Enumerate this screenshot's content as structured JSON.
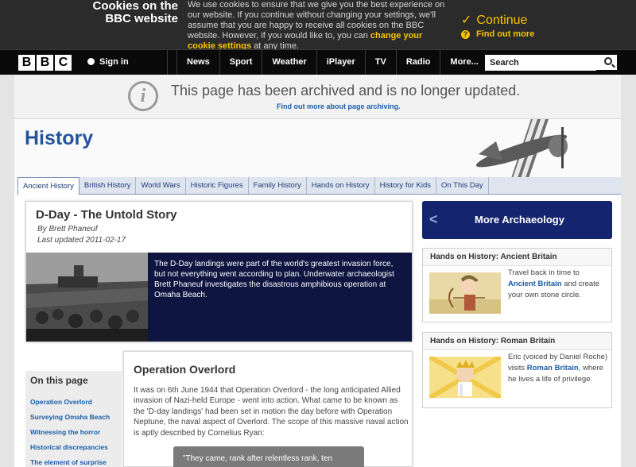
{
  "cookie_banner": {
    "title_line1": "Cookies on the",
    "title_line2": "BBC website",
    "text_start": "We use cookies to ensure that we give you the best experience on our website. If you continue without changing your settings, we'll assume that you are happy to receive all cookies on the BBC website. However, if you would like to, you can ",
    "text_link": "change your cookie settings",
    "text_end": " at any time.",
    "continue_label": "Continue",
    "find_out_more_label": "Find out more",
    "accent_color": "#f8c300"
  },
  "bbc_nav": {
    "logo_letters": [
      "B",
      "B",
      "C"
    ],
    "sign_in_label": "Sign in",
    "items": [
      "News",
      "Sport",
      "Weather",
      "iPlayer",
      "TV",
      "Radio",
      "More..."
    ],
    "search_placeholder": "Search"
  },
  "archive_notice": {
    "icon_glyph": "i",
    "message": "This page has been archived and is no longer updated.",
    "link": "Find out more about page archiving."
  },
  "section": {
    "title": "History",
    "tabs": [
      "Ancient History",
      "British History",
      "World Wars",
      "Historic Figures",
      "Family History",
      "Hands on History",
      "History for Kids",
      "On This Day"
    ],
    "active_tab": "Ancient History"
  },
  "article": {
    "title": "D-Day - The Untold Story",
    "author": "By Brett Phaneuf",
    "updated": "Last updated 2011-02-17",
    "summary": "The D-Day landings were part of the world's greatest invasion force, but not everything went according to plan. Underwater archaeologist Brett Phaneuf investigates the disastrous amphibious operation at Omaha Beach."
  },
  "sidebar": {
    "more_label": "More Archaeology",
    "cards": [
      {
        "heading": "Hands on History: Ancient Britain",
        "text_before": "Travel back in time to ",
        "link": "Ancient Britain",
        "text_after": " and create your own stone circle."
      },
      {
        "heading": "Hands on History: Roman Britain",
        "text_before": "Eric (voiced by Daniel Roche) visits ",
        "link": "Roman Britain",
        "text_after": ", where he lives a life of privilege."
      }
    ]
  },
  "on_this_page": {
    "title": "On this page",
    "items": [
      "Operation Overlord",
      "Surveying Omaha Beach",
      "Witnessing the horror",
      "Historical discrepancies",
      "The element of surprise"
    ]
  },
  "content": {
    "heading": "Operation Overlord",
    "paragraph": "It was on 6th June 1944 that Operation Overlord - the long anticipated Allied invasion of Nazi-held Europe - went into action. What came to be known as the 'D-day landings' had been set in motion the day before with Operation Neptune, the naval aspect of Overlord. The scope of this massive naval action is aptly described by Cornelius Ryan:",
    "quote": "\"They came, rank after relentless rank, ten"
  }
}
